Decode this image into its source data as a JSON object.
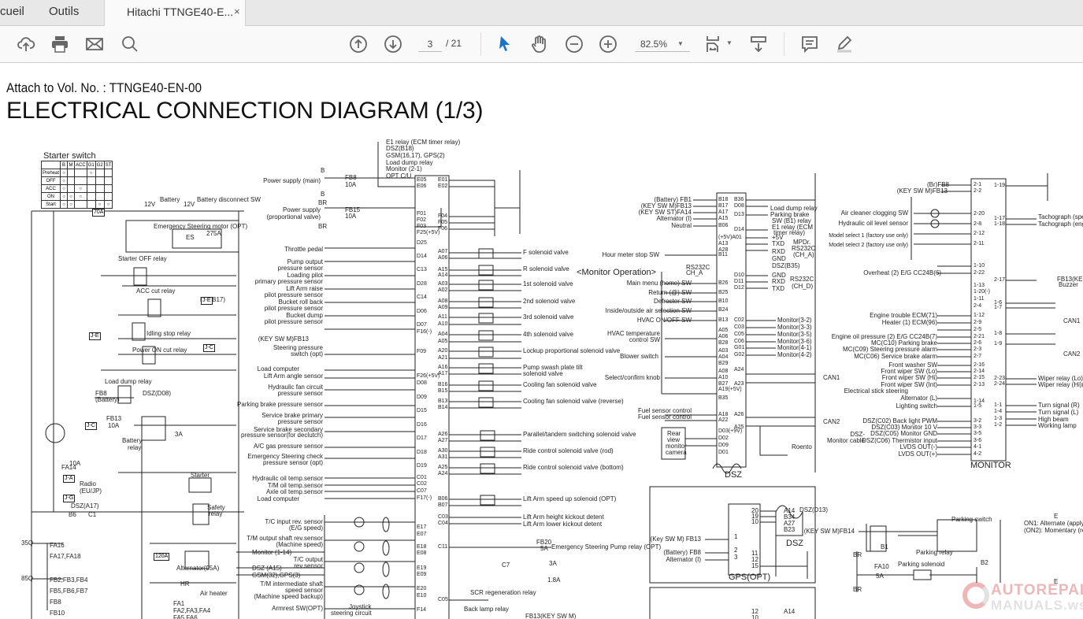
{
  "tabs": {
    "home": "cueil",
    "tools": "Outils",
    "document": "Hitachi TTNGE40-E...",
    "close": "×"
  },
  "toolbar": {
    "page_current": "3",
    "page_total": "/ 21",
    "zoom": "82.5%"
  },
  "document": {
    "subtitle": "Attach to Vol. No. : TTNGE40-EN-00",
    "title": "ELECTRICAL CONNECTION DIAGRAM (1/3)"
  },
  "starter_switch": {
    "title": "Starter switch",
    "cols": [
      "",
      "B",
      "M",
      "ACC",
      "G1",
      "G2",
      "ST"
    ],
    "rows": [
      "Preheat",
      "OFF",
      "ACC",
      "ON",
      "Start"
    ]
  },
  "left": [
    "Battery",
    "12V",
    "12V",
    "Battery disconnect SW",
    "70A",
    "Emergency Steering motor (OPT)",
    "ES",
    "275A",
    "Starter OFF relay",
    "ACC cut relay",
    "MC(B17)",
    "Idling stop relay",
    "Power ON cut relay",
    "Load dump relay",
    "FB8",
    "(Battery)",
    "DSZ(D08)",
    "FB13",
    "10A",
    "Battery",
    "relay",
    "3A",
    "Starter",
    "Radio",
    "(EU/JP)",
    "Safety",
    "relay",
    "DSZ(A17)",
    "B6",
    "C1",
    "Alternator(95A)",
    "Air heater",
    "HR",
    "35Q",
    "FA16",
    "FA17,FA18",
    "85Q",
    "FB2,FB3,FB4",
    "FB5,FB6,FB7",
    "FB8",
    "FB10",
    "FA1",
    "FA2,FA3,FA4",
    "FA5,FA6",
    "J-E",
    "J-E",
    "J-C",
    "J-C",
    "J-A",
    "J-G",
    "120A",
    "FA14",
    "10A"
  ],
  "ecm_top": [
    "E1 relay (ECM timer relay)",
    "DSZ(B18)",
    "GSM(16,17), GPS(2)",
    "Load dump relay",
    "Monitor (2-1)",
    "OPT C/U"
  ],
  "ecm_inputs": [
    "Power supply (main)",
    "Power supply",
    "(proportional valve)",
    "Throttle pedal",
    "Pump output",
    "pressure sensor",
    "Loading pilot",
    "primary pressure sensor",
    "Lift Arm raise",
    "pilot pressure sensor",
    "Bucket roll back",
    "pilot pressure sensor",
    "Bucket dump",
    "pilot pressure sensor",
    "(KEY SW M)FB13",
    "Steering pressure",
    "switch (opt)",
    "Load computer",
    "Lift Arm angle sensor",
    "Hydraulic fan circuit",
    "pressure sensor",
    "Parking brake pressure sensor",
    "Service brake primary",
    "pressure sensor",
    "Service brake secondary",
    "pressure sensor(for declutch)",
    "A/C gas pressure sensor",
    "Emergency Steering check",
    "pressure sensor (opt)",
    "Hydraulic oil temp.sensor",
    "T/M oil temp.sensor",
    "Axle oil temp.sensor",
    "Load computer",
    "T/C input rev. sensor",
    "(E/G speed)",
    "T/M output shaft rev.sensor",
    "(Machine speed)",
    "T/C output",
    "rev.sensor",
    "T/M intermediate shaft",
    "speed sensor",
    "(Machine speed backup)",
    "Armrest SW(OPT)",
    "Joystick",
    "steering circuit",
    "Monitor (1-14)",
    "DSZ (A15)",
    "GSM(32),GPS(3)",
    "B",
    "B",
    "BR",
    "BR",
    "FB8",
    "10A",
    "FB15",
    "10A"
  ],
  "ecm_pins_left": [
    "E05",
    "E06",
    "F01",
    "F02",
    "F03",
    "F25(+5V)",
    "D25",
    "D14",
    "C13",
    "D28",
    "C14",
    "D06",
    "D07",
    "F16(-)",
    "F09",
    "F26(+5V)",
    "D08",
    "D09",
    "D15",
    "D16",
    "D17",
    "D18",
    "D19",
    "C01",
    "C02",
    "C07",
    "F17(-)",
    "E17",
    "E07",
    "E18",
    "E08",
    "E19",
    "E09",
    "E20",
    "E10",
    "F14"
  ],
  "ecm_pins_right": [
    "E01",
    "E02",
    "F04",
    "F05",
    "F06",
    "A07",
    "A06",
    "A15",
    "A14",
    "A03",
    "A02",
    "A08",
    "A09",
    "A11",
    "A10",
    "A04",
    "A05",
    "A20",
    "A21",
    "A16",
    "A17",
    "B16",
    "B15",
    "B13",
    "B14",
    "A26",
    "A27",
    "A30",
    "A31",
    "A25",
    "A24",
    "B06",
    "B07",
    "C03",
    "C04",
    "C11",
    "C05"
  ],
  "ecm_outputs": [
    "F solenoid valve",
    "R solenoid valve",
    "1st solenoid valve",
    "2nd solenoid valve",
    "3rd solenoid valve",
    "4th solenoid valve",
    "Lockup proportional solenoid valve",
    "Pump swash plate tilt",
    "solenoid valve",
    "Cooling fan solenoid valve",
    "Cooling fan solenoid valve (reverse)",
    "Parallel/tandem switching solenoid valve",
    "Ride control solenoid valve (rod)",
    "Ride control solenoid valve (bottom)",
    "Lift Arm speed up solenoid (OPT)",
    "Lift Arm height kickout detent",
    "Lift Arm lower kickout detent",
    "Emergency Steering Pump relay (OPT)",
    "FB20",
    "5A",
    "C7",
    "SCR regeneration relay",
    "Back lamp relay",
    "FB13(KEY SW M)",
    "1.8A",
    "3A"
  ],
  "dsz_inputs": [
    "(Battery) FB1",
    "(KEY SW M)FB13",
    "(KEY SW ST)FA14",
    "Alternator (I)",
    "Neutral",
    "Hour meter stop SW",
    "<Monitor Operation>",
    "RS232C",
    "CH_A",
    "Main menu (home) SW",
    "Return (@) SW",
    "Defroster SW",
    "Inside/outside air selection SW",
    "HVAC ON/OFF SW",
    "HVAC temperature",
    "control SW",
    "Blower switch",
    "Select/confirm knob",
    "Fuel sensor control",
    "Fuel sensor control",
    "Rear",
    "view",
    "monitor",
    "camera"
  ],
  "dsz_pins_left": [
    "B18",
    "B17",
    "A17",
    "A15",
    "B06",
    "(+5V)A01",
    "A13",
    "A28",
    "B11",
    "B26",
    "B25",
    "B10",
    "B24",
    "B13",
    "A05",
    "A06",
    "B28",
    "A03",
    "A04",
    "B29",
    "A08",
    "A10",
    "B27",
    "A19(+5V)",
    "B35",
    "A18",
    "A22",
    "D03(+9V)",
    "D02",
    "D09",
    "D01"
  ],
  "dsz_pins_right": [
    "B36",
    "D08",
    "D13",
    "D14",
    "D10",
    "D11",
    "D12",
    "C02",
    "C03",
    "C05",
    "C06",
    "G01",
    "G02",
    "A24",
    "A23",
    "A26",
    "A25"
  ],
  "dsz_outputs": [
    "Load dump relay",
    "Parking brake",
    "SW (B1) relay",
    "E1 relay (ECM",
    "timer relay)",
    "+5V",
    "TXD",
    "RXD",
    "GND",
    "DSZ(B35)",
    "MPDr.",
    "RS232C",
    "(CH_A)",
    "GND",
    "RXD",
    "TXD",
    "RS232C",
    "(CH_D)",
    "Monitor(3-2)",
    "Monitor(3-3)",
    "Monitor(3-5)",
    "Monitor(3-6)",
    "Monitor(4-1)",
    "Monitor(4-2)",
    "CAN1",
    "CAN2",
    "Roento",
    "DSZ"
  ],
  "monitor_inputs": [
    "(Br)FB8",
    "(KEY SW M)FB13",
    "Air cleaner clogging SW",
    "Hydraulic oil level sensor",
    "Model select 1 (factory use only)",
    "Model select 2 (factory use only)",
    "Overheat (2) E/G CC24B(6)",
    "Engine trouble ECM(71)",
    "Heater (1) ECM(96)",
    "Engine oil pressure (2) E/G CC24B(7)",
    "MC(C10) Parking brake",
    "MC(C09) Steering pressure alarm",
    "MC(C06) Service brake alarm",
    "Front washer SW",
    "Front wiper SW (Lo)",
    "Front wiper SW (Hi)",
    "Front wiper SW (Int)",
    "Electrical stick steering",
    "Alternator (L)",
    "Lighting switch",
    "DSZ(C02) Back light PWM",
    "DSZ(C03) Monitor 10 V",
    "DSZ(C05) Monitor GND",
    "DSZ(C06) Thermistor input",
    "LVDS OUT(-)",
    "LVDS OUT(+)",
    "DSZ-",
    "Monitor cable"
  ],
  "monitor_pins_left": [
    "2-1",
    "2-2",
    "2-20",
    "2-8",
    "2-12",
    "2-11",
    "1-10",
    "2-22",
    "1-13",
    "1-20(-)",
    "1-11",
    "2-4",
    "1-12",
    "2-9",
    "2-5",
    "2-21",
    "2-6",
    "2-3",
    "2-7",
    "2-16",
    "2-14",
    "2-15",
    "2-13",
    "1-14",
    "1-5",
    "3-2",
    "3-3",
    "3-5",
    "3-6",
    "4-1",
    "4-2"
  ],
  "monitor_pins_right": [
    "1-19",
    "1-17",
    "1-18",
    "2-17",
    "1-6",
    "1-7",
    "1-8",
    "1-9",
    "2-23",
    "2-24",
    "1-1",
    "1-4",
    "1-3",
    "1-2"
  ],
  "monitor_outputs": [
    "Tachograph (speed)",
    "Tachograph (engine",
    "FB13(KEY",
    "Buzzer",
    "CAN1",
    "CAN2",
    "Wiper relay (Lo)(",
    "Wiper relay (Hi)(F",
    "Turn signal (R)",
    "Turn signal (L)",
    "High beam",
    "Working lamp",
    "MONITOR"
  ],
  "gps": [
    "(Key SW M) FB13",
    "(Battery) FB8",
    "Alternator (I)",
    "1",
    "2",
    "3",
    "20",
    "19",
    "10",
    "11",
    "12",
    "15",
    "A14",
    "B34",
    "A27",
    "B23",
    "DSZ",
    "GPS(OPT)",
    "12",
    "10",
    "A14"
  ],
  "parking": [
    "DSZ(D13)",
    "(KEY SW M)FB14",
    "Parking switch",
    "ON1: Alternate (apply",
    "(ON2): Momentary (re",
    "B1",
    "Parking relay",
    "BR",
    "FA10",
    "5A",
    "Parking solenoid",
    "B2",
    "BR",
    "E",
    "E"
  ],
  "watermark": {
    "line1": "AUTOREPAIR",
    "line2": "MANUALS.ws"
  }
}
